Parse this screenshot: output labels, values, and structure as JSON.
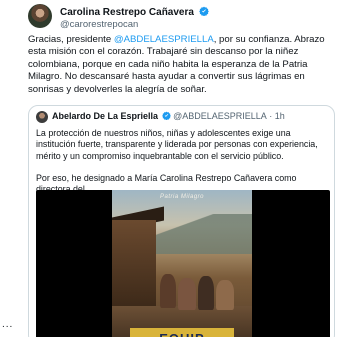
{
  "post": {
    "author": {
      "display_name": "Carolina Restrepo Cañavera",
      "handle": "@carorestrepocan",
      "verified_icon": "verified-badge-icon"
    },
    "text_parts": {
      "part1": "Gracias, presidente ",
      "mention": "@ABDELAESPRIELLA",
      "part2": ", por su confianza. Abrazo esta misión con el corazón. Trabajaré sin descanso por la niñez colombiana, porque en cada niño habita la esperanza de la Patria Milagro. No descansaré hasta ayudar a convertir sus lágrimas en sonrisas y devolverles la alegría de soñar."
    },
    "quoted": {
      "display_name": "Abelardo De La Espriella",
      "handle": "@ABDELAESPRIELLA",
      "time": "1h",
      "paragraph1": "La protección de nuestros niños, niñas y adolescentes exige una institución fuerte, transparente y liderada por personas con experiencia, mérito y un compromiso inquebrantable con el servicio público.",
      "paragraph2": "Por eso, he designado a María Carolina Restrepo Cañavera como directora del",
      "media": {
        "overlay_title": "EQUIP",
        "sky_caption": "Patria Milagro"
      }
    },
    "more_menu": "..."
  },
  "colors": {
    "accent": "#1d9bf0",
    "text": "#0f1419",
    "muted": "#536471",
    "border": "#cfd9de"
  }
}
